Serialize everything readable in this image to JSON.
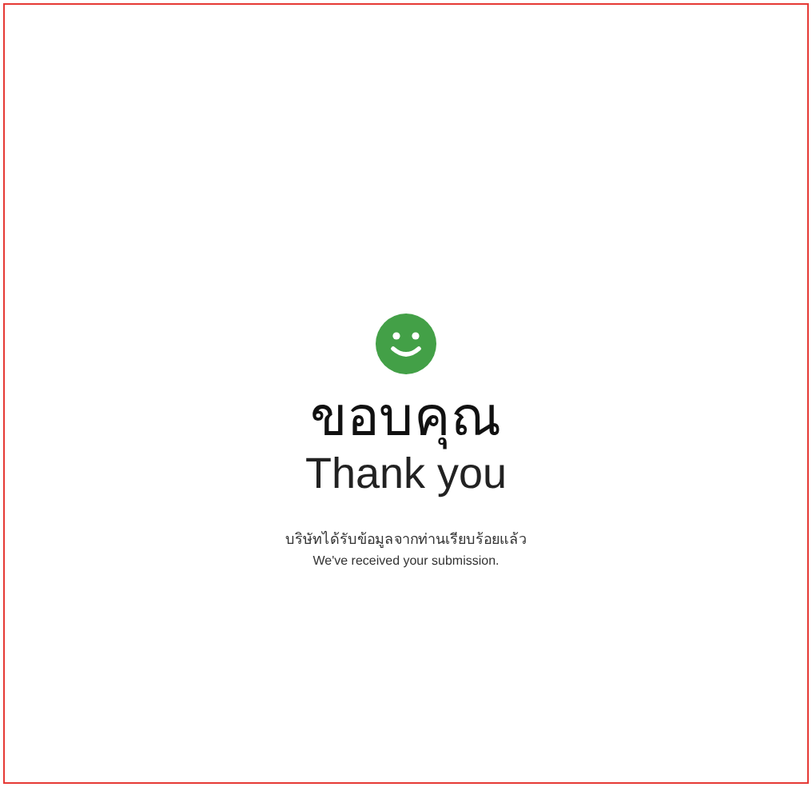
{
  "title_thai": "ขอบคุณ",
  "title_english": "Thank you",
  "message_thai": "บริษัทได้รับข้อมูลจากท่านเรียบร้อยแล้ว",
  "message_english": "We've received your submission."
}
